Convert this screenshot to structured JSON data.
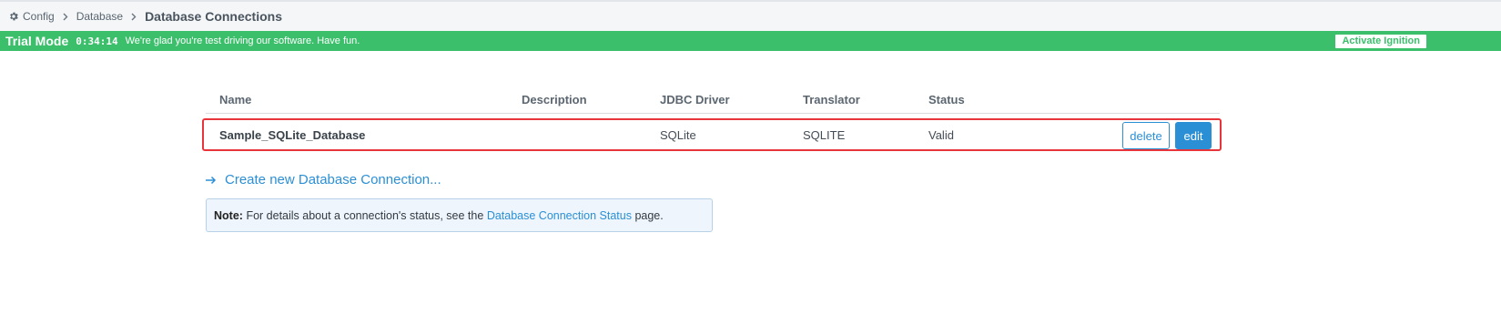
{
  "breadcrumb": {
    "items": [
      "Config",
      "Database"
    ],
    "current": "Database Connections"
  },
  "trial": {
    "mode_label": "Trial Mode",
    "timer": "0:34:14",
    "message": "We're glad you're test driving our software. Have fun.",
    "activate_label": "Activate Ignition"
  },
  "table": {
    "columns": [
      "Name",
      "Description",
      "JDBC Driver",
      "Translator",
      "Status"
    ],
    "rows": [
      {
        "name": "Sample_SQLite_Database",
        "description": "",
        "driver": "SQLite",
        "translator": "SQLITE",
        "status": "Valid",
        "delete_label": "delete",
        "edit_label": "edit"
      }
    ]
  },
  "create_link": "Create new Database Connection...",
  "note": {
    "label": "Note:",
    "text_before": "For details about a connection's status, see the",
    "link": "Database Connection Status",
    "text_after": "page."
  },
  "colors": {
    "trial_banner": "#3bbf6b",
    "accent": "#2b8fd6",
    "highlight": "#e8353b"
  }
}
